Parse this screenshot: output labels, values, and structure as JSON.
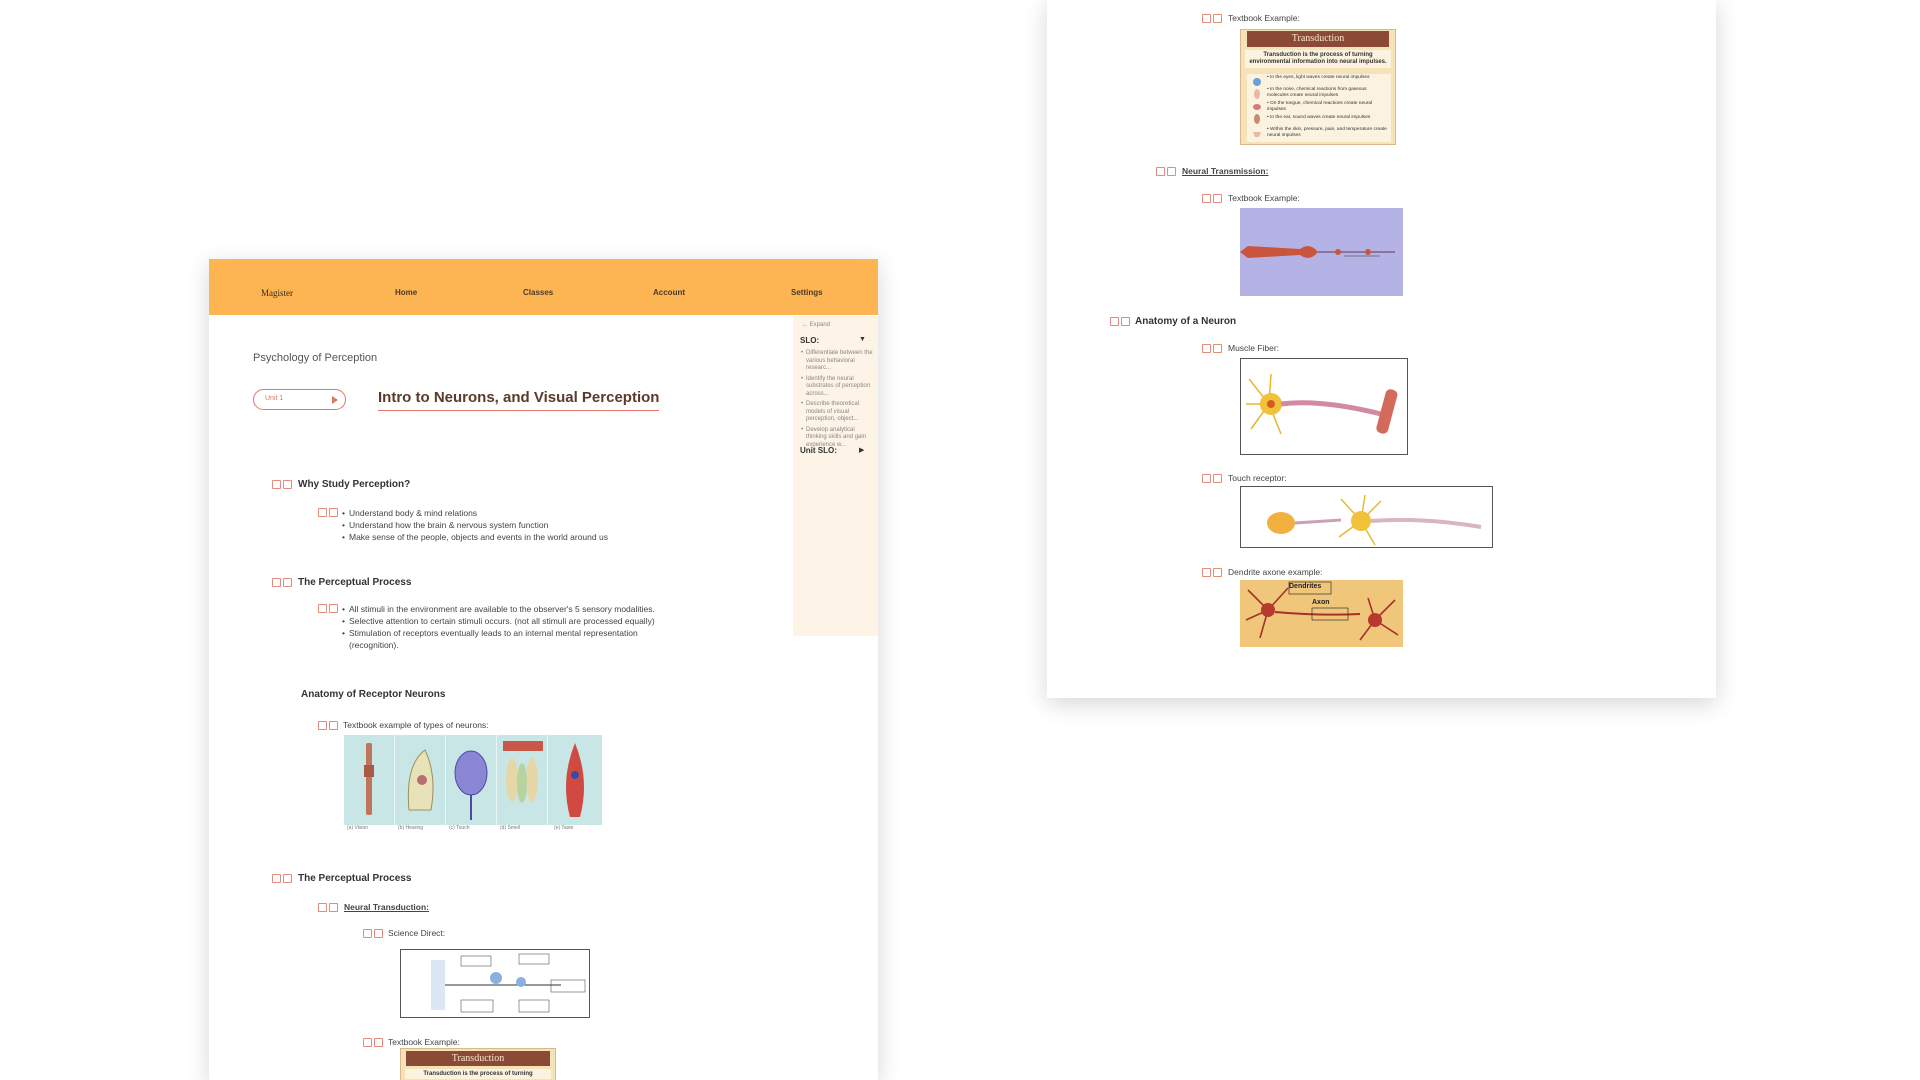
{
  "nav": {
    "logo": "Magister",
    "items": [
      "Home",
      "Classes",
      "Account",
      "Settings"
    ]
  },
  "course": {
    "title": "Psychology of Perception",
    "unit_label": "Unit 1",
    "lesson_title": "Intro to Neurons, and Visual Perception"
  },
  "slo_panel": {
    "expand": "Expand",
    "slo_heading": "SLO:",
    "items": [
      "Differentiate between the various behavioral researc...",
      "Identify the neural substrates of perception across...",
      "Describe theoretical models of visual perception, object...",
      "Develop analytical thinking skills and gain experience w..."
    ],
    "unit_slo_heading": "Unit SLO:"
  },
  "content": {
    "why": {
      "heading": "Why Study Perception?",
      "bullets": [
        "Understand body & mind relations",
        "Understand how the brain & nervous system function",
        "Make sense of the people, objects and events in the world around us"
      ]
    },
    "process1": {
      "heading": "The Perceptual Process",
      "bullets": [
        "All stimuli in the environment are available to the observer's 5 sensory modalities.",
        "Selective attention to certain stimuli occurs. (not all stimuli are processed equally)",
        "Stimulation of receptors eventually leads to an internal mental representation (recognition)."
      ]
    },
    "anatomy_receptor": {
      "heading": "Anatomy of Receptor Neurons",
      "caption": "Textbook example of types of neurons:",
      "image_labels": [
        "(a) Vision",
        "(b) Hearing",
        "(c) Touch",
        "(d) Smell",
        "(e) Taste"
      ]
    },
    "process2": {
      "heading": "The Perceptual Process",
      "neural_transduction": "Neural Transduction:",
      "science_direct": "Science Direct:",
      "textbook_example": "Textbook Example:"
    },
    "transduction": {
      "title": "Transduction",
      "subtitle": "Transduction is the process of turning environmental information into neural impulses.",
      "subtitle_cut": "Transduction is the process of turning",
      "items": [
        "In the eyes, light waves create neural impulses",
        "In the nose, chemical reactions from gaseous molecules create neural impulses",
        "On the tongue, chemical reactions create neural impulses",
        "In the ear, sound waves create neural impulses",
        "Within the skin, pressure, pain, and temperature create neural impulses"
      ]
    },
    "right": {
      "textbook_example_1": "Textbook Example:",
      "neural_transmission": "Neural Transmission:",
      "textbook_example_2": "Textbook Example:",
      "anatomy_neuron": "Anatomy of a Neuron",
      "muscle_fiber": "Muscle Fiber:",
      "touch_receptor": "Touch receptor:",
      "dendrite_axone": "Dendrite axone example:",
      "dendrites_label": "Dendrites",
      "axon_label": "Axon"
    }
  },
  "colors": {
    "nav_bg": "#fdb452",
    "accent": "#e07868",
    "panel_bg": "#fdf3e6"
  }
}
